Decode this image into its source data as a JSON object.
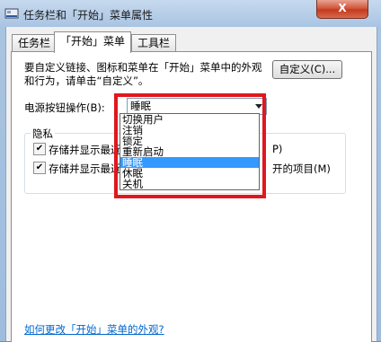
{
  "window": {
    "title": "任务栏和「开始」菜单属性",
    "close_label": "X"
  },
  "tabs": [
    {
      "label": "任务栏",
      "active": false
    },
    {
      "label": "「开始」菜单",
      "active": true
    },
    {
      "label": "工具栏",
      "active": false
    }
  ],
  "start_menu": {
    "description": "要自定义链接、图标和菜单在「开始」菜单中的外观和行为，请单击“自定义”。",
    "customize_button": "自定义(C)...",
    "power_label": "电源按钮操作(B):",
    "power_value": "睡眠",
    "power_options": [
      "切换用户",
      "注销",
      "锁定",
      "重新启动",
      "睡眠",
      "休眠",
      "关机"
    ],
    "selected_option": "睡眠",
    "privacy": {
      "title": "隐私",
      "item1": "存储并显示最近",
      "item1_tail": "P)",
      "item2": "存储并显示最近",
      "item2_tail": "开的项目(M)"
    },
    "help_link": "如何更改「开始」菜单的外观?"
  },
  "colors": {
    "highlight_border": "#e0171e",
    "selection": "#3399ff",
    "link": "#0066cc"
  }
}
